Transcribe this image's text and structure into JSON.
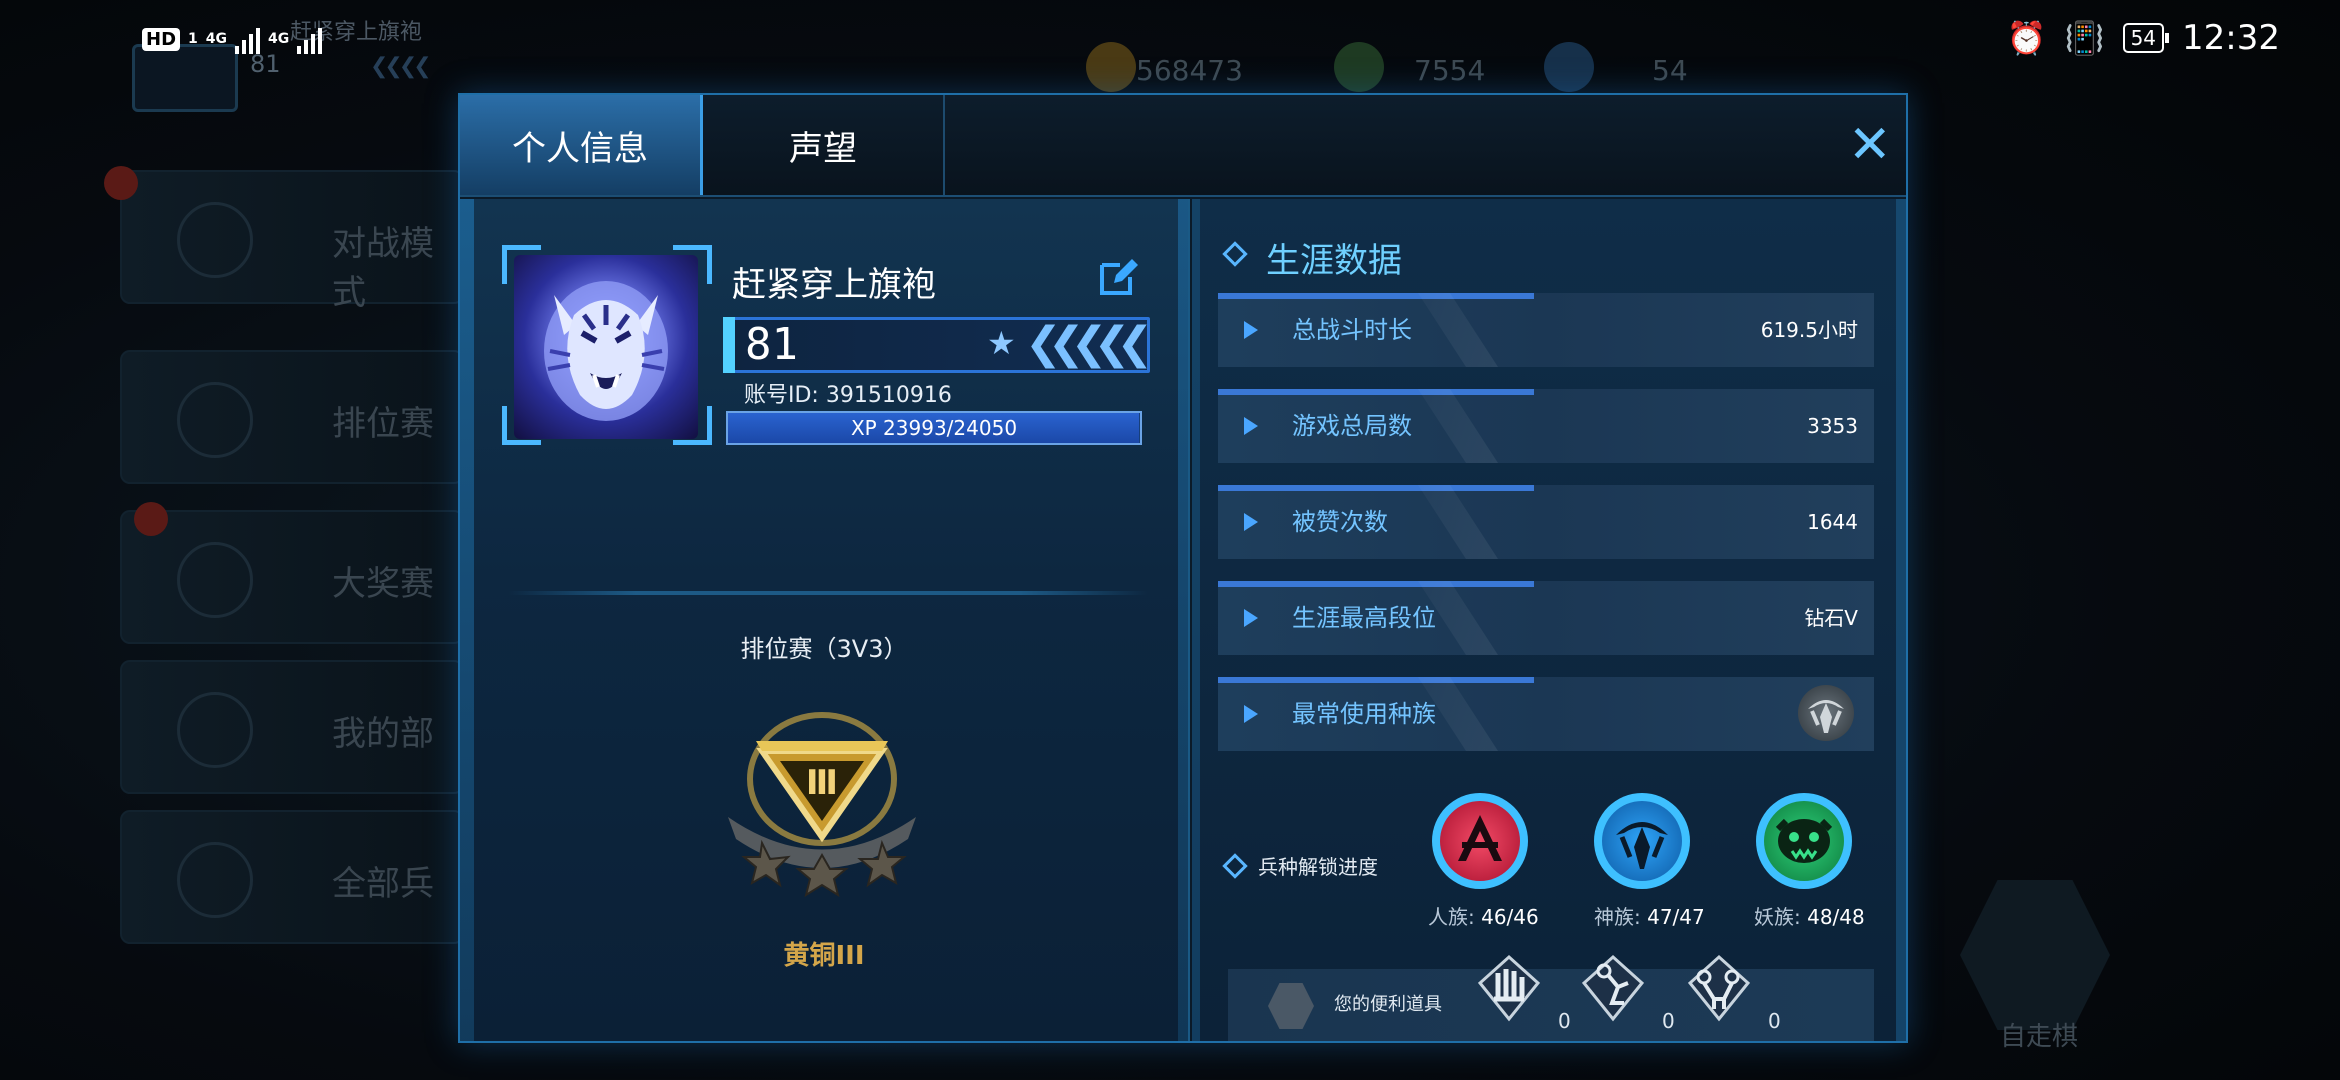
{
  "status_bar": {
    "left": {
      "hd": "HD",
      "sim1": "1",
      "net1": "4G",
      "net2": "4G"
    },
    "battery": "54",
    "time": "12:32"
  },
  "background": {
    "player_name": "赶紧穿上旗袍",
    "level": "81",
    "resources": [
      "568473",
      "7554",
      "54"
    ],
    "menu": [
      "对战模式",
      "排位赛",
      "大奖赛",
      "我的部",
      "全部兵"
    ],
    "right_label": "自走棋"
  },
  "tabs": [
    {
      "label": "个人信息",
      "active": true
    },
    {
      "label": "声望",
      "active": false
    }
  ],
  "close_symbol": "✕",
  "profile": {
    "name": "赶紧穿上旗袍",
    "level": "81",
    "account_id_label": "账号ID:",
    "account_id": "391510916",
    "xp_text": "XP 23993/24050",
    "xp_current": 23993,
    "xp_max": 24050,
    "avatar_icon": "tiger-avatar"
  },
  "ranked": {
    "title": "排位赛（3V3）",
    "rank_name": "黄铜III",
    "badge_numeral": "Ⅲ",
    "stars": 3
  },
  "career": {
    "title": "生涯数据",
    "rows": [
      {
        "label": "总战斗时长",
        "value": "619.5小时"
      },
      {
        "label": "游戏总局数",
        "value": "3353"
      },
      {
        "label": "被赞次数",
        "value": "1644"
      },
      {
        "label": "生涯最高段位",
        "value": "钻石V"
      },
      {
        "label": "最常使用种族",
        "value": "",
        "icon": "shen-race-emblem"
      }
    ]
  },
  "unlock": {
    "label": "兵种解锁进度",
    "races": [
      {
        "name": "人族:",
        "progress": "46/46",
        "color": "#e0284a",
        "icon": "human-race-icon"
      },
      {
        "name": "神族:",
        "progress": "47/47",
        "color": "#1e8ee6",
        "icon": "god-race-icon"
      },
      {
        "name": "妖族:",
        "progress": "48/48",
        "color": "#1fa35c",
        "icon": "demon-race-icon"
      }
    ]
  },
  "tools": {
    "label": "您的便利道具",
    "items": [
      {
        "icon": "tool-hand-icon",
        "count": "0"
      },
      {
        "icon": "tool-robot-icon",
        "count": "0"
      },
      {
        "icon": "tool-arm-icon",
        "count": "0"
      }
    ]
  }
}
